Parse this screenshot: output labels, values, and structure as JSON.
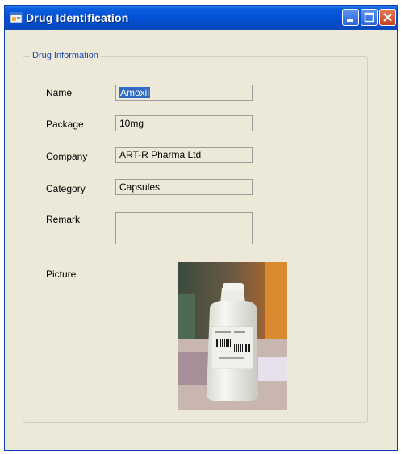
{
  "window": {
    "title": "Drug Identification"
  },
  "group": {
    "title": "Drug Information"
  },
  "fields": {
    "name": {
      "label": "Name",
      "value": "Amoxil"
    },
    "package": {
      "label": "Package",
      "value": "10mg"
    },
    "company": {
      "label": "Company",
      "value": "ART-R Pharma Ltd"
    },
    "category": {
      "label": "Category",
      "value": "Capsules"
    },
    "remark": {
      "label": "Remark",
      "value": ""
    },
    "picture": {
      "label": "Picture"
    }
  },
  "colors": {
    "titlebar": "#0452d6",
    "group_title": "#1e46b0",
    "selection": "#316ac5",
    "window_bg": "#ece9d8"
  },
  "icons": [
    "app-icon",
    "minimize-icon",
    "maximize-icon",
    "close-icon"
  ]
}
